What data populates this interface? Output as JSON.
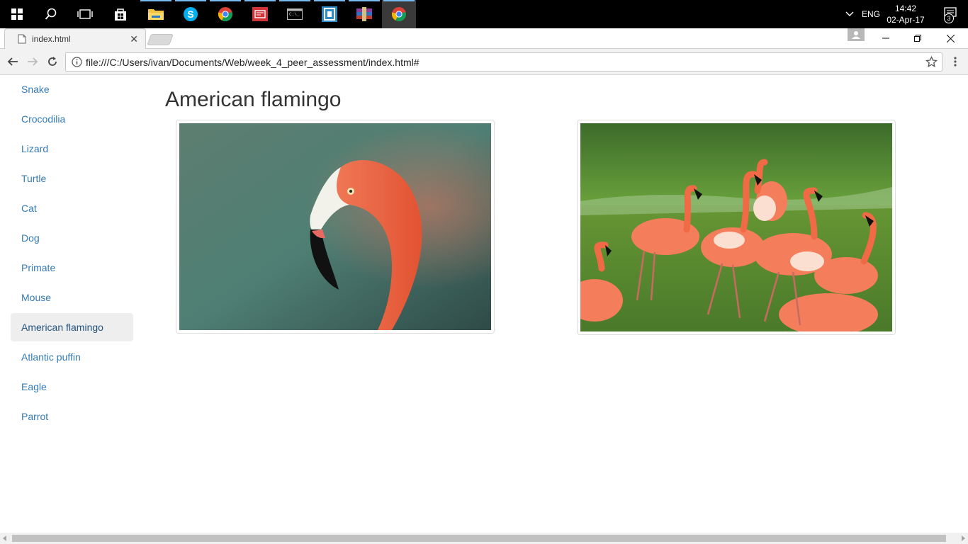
{
  "taskbar": {
    "apps": [
      {
        "name": "start-button"
      },
      {
        "name": "search"
      },
      {
        "name": "task-view"
      },
      {
        "name": "store"
      },
      {
        "name": "file-explorer"
      },
      {
        "name": "skype"
      },
      {
        "name": "chrome"
      },
      {
        "name": "news"
      },
      {
        "name": "command-prompt"
      },
      {
        "name": "app-bracket"
      },
      {
        "name": "winrar"
      },
      {
        "name": "chrome-active"
      }
    ],
    "language": "ENG",
    "time": "14:42",
    "date": "02-Apr-17",
    "notification_count": "3"
  },
  "browser": {
    "tab_title": "index.html",
    "url": "file:///C:/Users/ivan/Documents/Web/week_4_peer_assessment/index.html#"
  },
  "sidebar": {
    "items": [
      {
        "label": "Snake"
      },
      {
        "label": "Crocodilia"
      },
      {
        "label": "Lizard"
      },
      {
        "label": "Turtle"
      },
      {
        "label": "Cat"
      },
      {
        "label": "Dog"
      },
      {
        "label": "Primate"
      },
      {
        "label": "Mouse"
      },
      {
        "label": "American flamingo"
      },
      {
        "label": "Atlantic puffin"
      },
      {
        "label": "Eagle"
      },
      {
        "label": "Parrot"
      }
    ],
    "active_index": 8
  },
  "main": {
    "heading": "American flamingo",
    "images": [
      {
        "subject": "flamingo-closeup"
      },
      {
        "subject": "flamingo-flock"
      }
    ]
  },
  "colors": {
    "link": "#337ab7",
    "active_bg": "#eeeeee",
    "flamingo": "#f2623f"
  }
}
